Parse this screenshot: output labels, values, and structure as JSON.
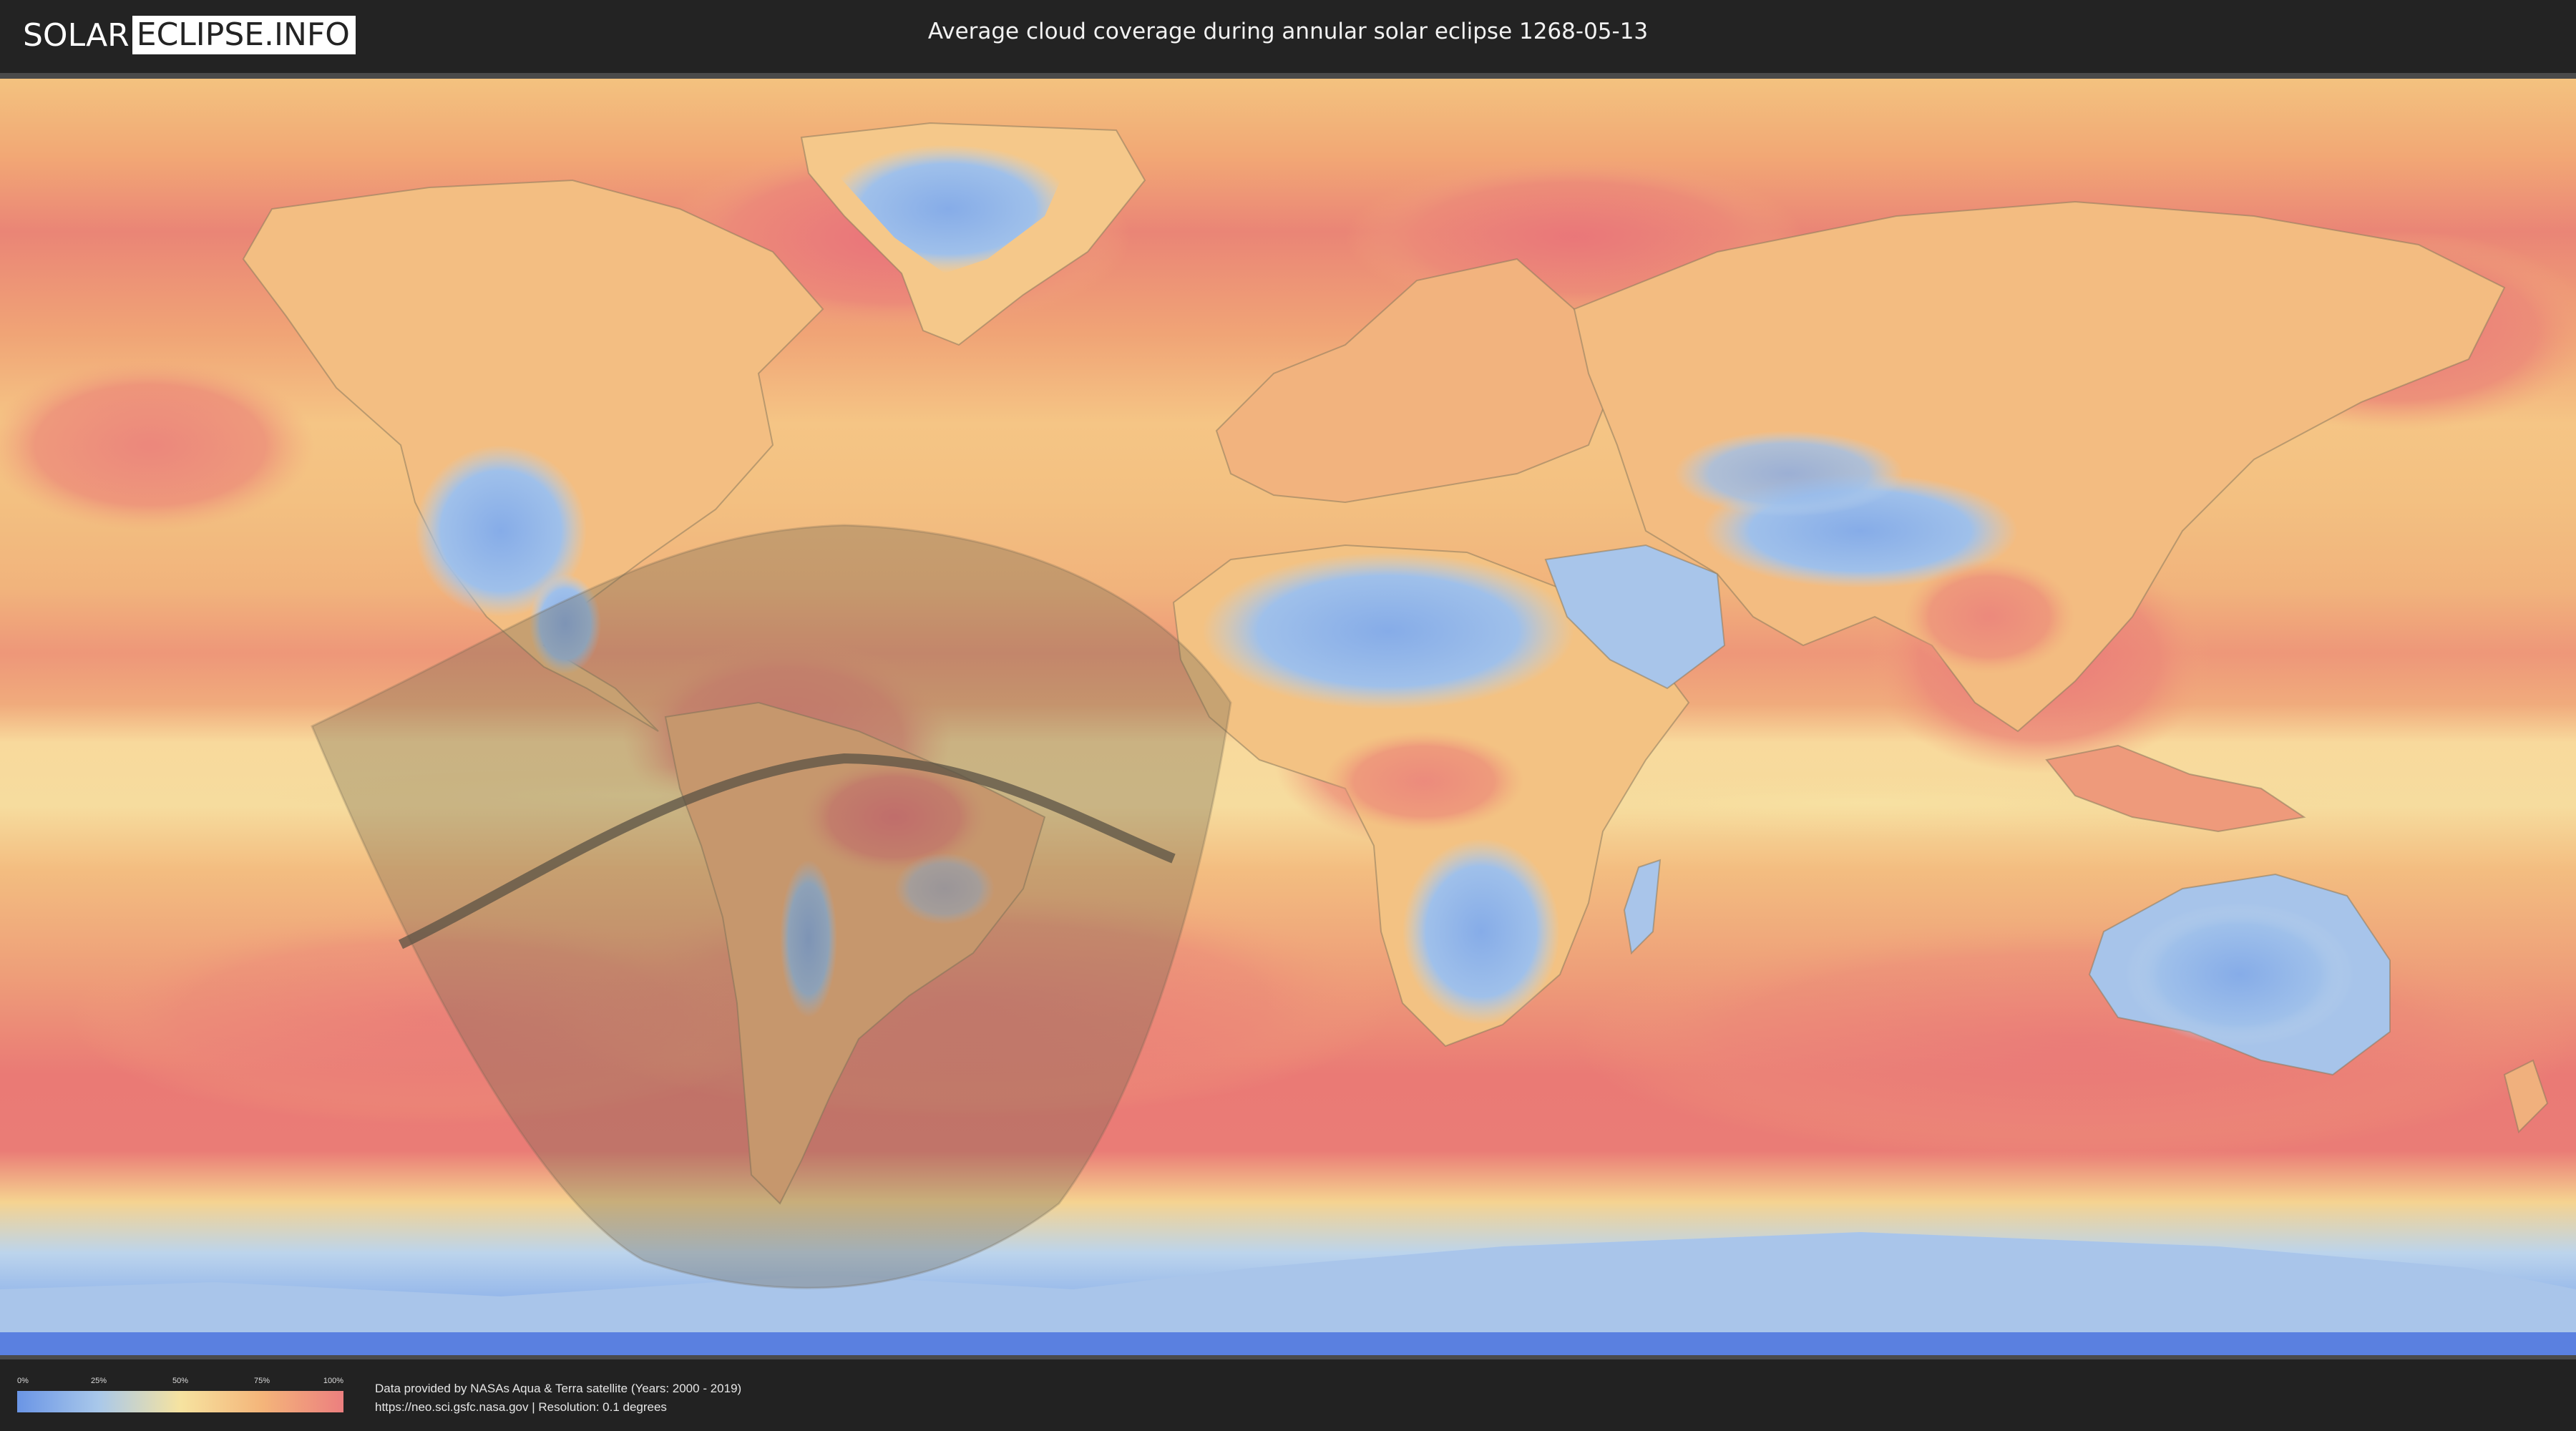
{
  "header": {
    "logo_left": "SOLAR",
    "logo_right": "ECLIPSE.INFO",
    "title": "Average cloud coverage during annular solar eclipse 1268-05-13"
  },
  "legend": {
    "ticks": [
      "0%",
      "25%",
      "50%",
      "75%",
      "100%"
    ],
    "colors": [
      "#6a95e6",
      "#a9c8ea",
      "#f6e3a0",
      "#f4b57a",
      "#ec7f7f"
    ]
  },
  "credits": {
    "line1": "Data provided by NASAs Aqua & Terra satellite (Years: 2000 - 2019)",
    "line2": "https://neo.sci.gsfc.nasa.gov | Resolution: 0.1 degrees"
  }
}
